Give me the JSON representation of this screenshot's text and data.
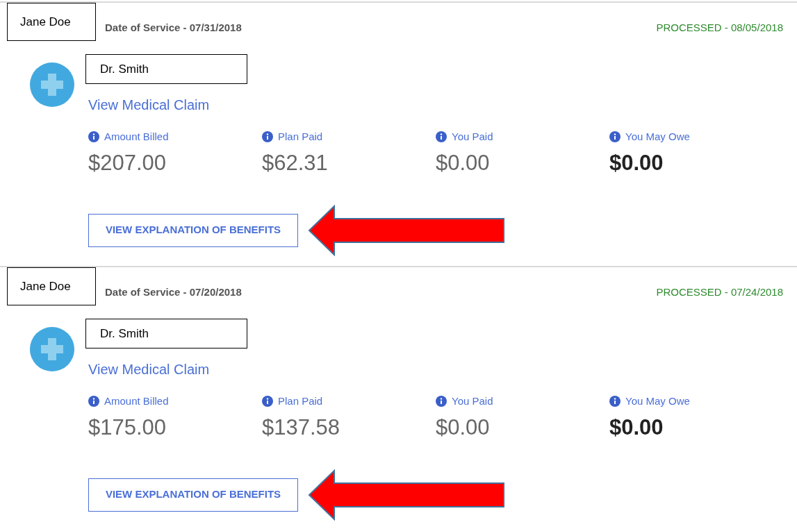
{
  "claims": [
    {
      "patient": "Jane Doe",
      "date_of_service": "Date of Service - 07/31/2018",
      "status": "PROCESSED - 08/05/2018",
      "provider": "Dr. Smith",
      "link": "View Medical Claim",
      "amounts": [
        {
          "label": "Amount Billed",
          "value": "$207.00",
          "emphasized": false
        },
        {
          "label": "Plan Paid",
          "value": "$62.31",
          "emphasized": false
        },
        {
          "label": "You Paid",
          "value": "$0.00",
          "emphasized": false
        },
        {
          "label": "You May Owe",
          "value": "$0.00",
          "emphasized": true
        }
      ],
      "button": "VIEW EXPLANATION OF BENEFITS"
    },
    {
      "patient": "Jane Doe",
      "date_of_service": "Date of Service - 07/20/2018",
      "status": "PROCESSED - 07/24/2018",
      "provider": "Dr. Smith",
      "link": "View Medical Claim",
      "amounts": [
        {
          "label": "Amount Billed",
          "value": "$175.00",
          "emphasized": false
        },
        {
          "label": "Plan Paid",
          "value": "$137.58",
          "emphasized": false
        },
        {
          "label": "You Paid",
          "value": "$0.00",
          "emphasized": false
        },
        {
          "label": "You May Owe",
          "value": "$0.00",
          "emphasized": true
        }
      ],
      "button": "VIEW EXPLANATION OF BENEFITS"
    }
  ]
}
